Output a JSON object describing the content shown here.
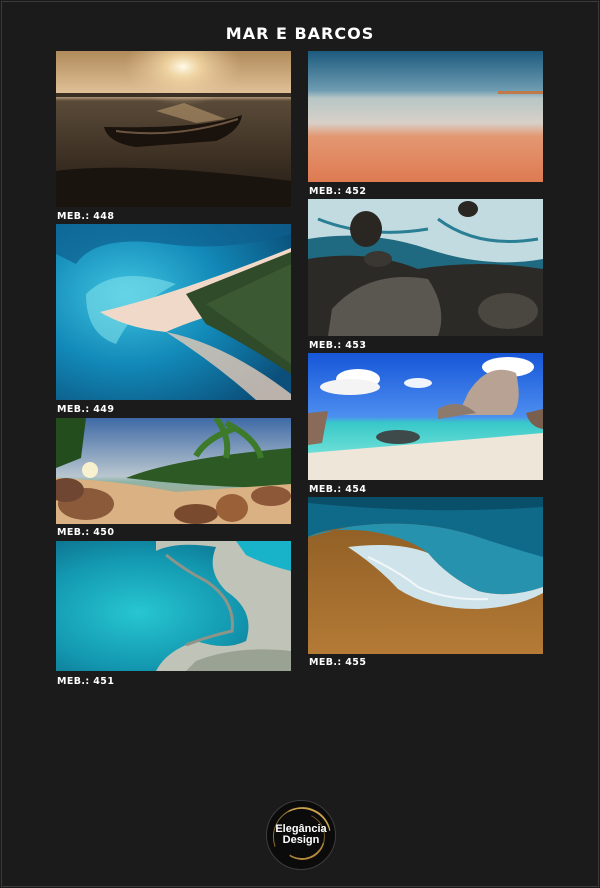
{
  "page": {
    "title": "MAR E BARCOS",
    "logo": {
      "line1": "Elegância",
      "line2": "Design"
    }
  },
  "left_column": [
    {
      "code": "MEB.: 448",
      "scene": "boat on tidal flat at sunset"
    },
    {
      "code": "MEB.: 449",
      "scene": "aerial sandbar with turquoise water"
    },
    {
      "code": "MEB.: 450",
      "scene": "tropical beach with palms and boulders"
    },
    {
      "code": "MEB.: 451",
      "scene": "aerial turquoise cove with rocks"
    }
  ],
  "right_column": [
    {
      "code": "MEB.: 452",
      "scene": "calm sea with pink sand at dusk"
    },
    {
      "code": "MEB.: 453",
      "scene": "waves crashing on dark rocks"
    },
    {
      "code": "MEB.: 454",
      "scene": "granite boulders and turquoise lagoon"
    },
    {
      "code": "MEB.: 455",
      "scene": "wave foam on golden sand"
    }
  ],
  "colors": {
    "background": "#1b1b1b",
    "text": "#ffffff",
    "logo_accent": "#c9a24a"
  }
}
